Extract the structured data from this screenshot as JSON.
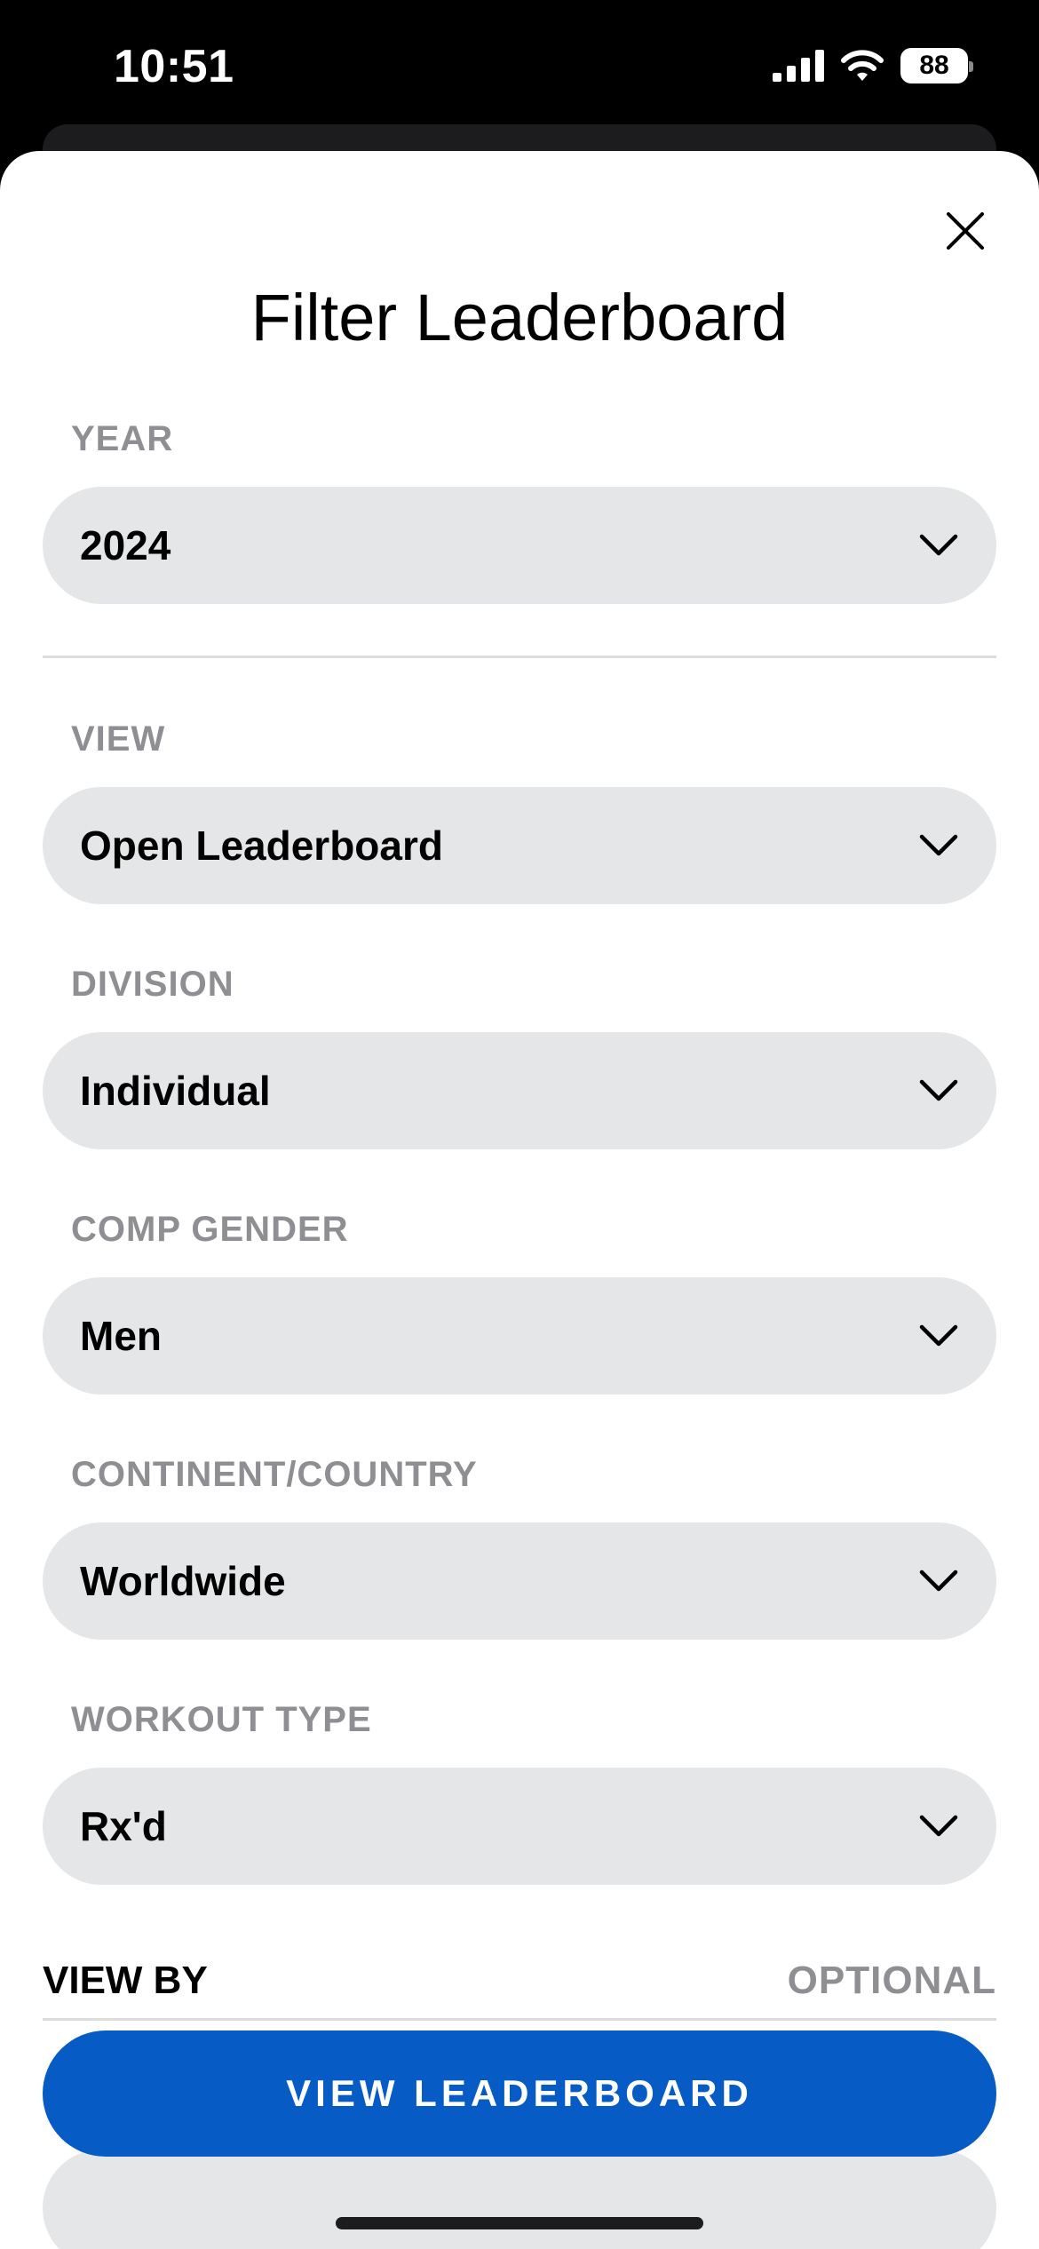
{
  "status_bar": {
    "time": "10:51",
    "battery": "88"
  },
  "sheet": {
    "title": "Filter Leaderboard",
    "fields": [
      {
        "label": "YEAR",
        "value": "2024"
      },
      {
        "label": "VIEW",
        "value": "Open Leaderboard"
      },
      {
        "label": "DIVISION",
        "value": "Individual"
      },
      {
        "label": "COMP GENDER",
        "value": "Men"
      },
      {
        "label": "CONTINENT/COUNTRY",
        "value": "Worldwide"
      },
      {
        "label": "WORKOUT TYPE",
        "value": "Rx'd"
      }
    ],
    "view_by": {
      "label": "VIEW BY",
      "optional": "OPTIONAL"
    },
    "cta_label": "VIEW LEADERBOARD"
  },
  "colors": {
    "accent": "#075bc5",
    "field_bg": "#e5e6e7",
    "label_gray": "#8e8e93"
  }
}
